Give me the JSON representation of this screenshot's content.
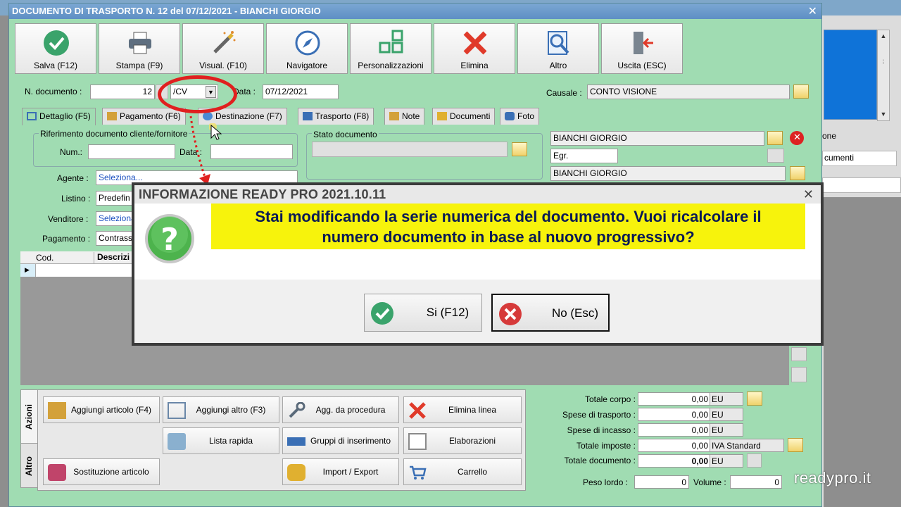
{
  "window": {
    "title": "DOCUMENTO DI TRASPORTO N. 12 del 07/12/2021 - BIANCHI GIORGIO",
    "close": "✕"
  },
  "toolbar": [
    {
      "label": "Salva (F12)",
      "icon": "check-icon"
    },
    {
      "label": "Stampa (F9)",
      "icon": "printer-icon"
    },
    {
      "label": "Visual. (F10)",
      "icon": "magic-wand-icon"
    },
    {
      "label": "Navigatore",
      "icon": "compass-icon"
    },
    {
      "label": "Personalizzazioni",
      "icon": "grid-icon"
    },
    {
      "label": "Elimina",
      "icon": "delete-x-icon"
    },
    {
      "label": "Altro",
      "icon": "magnifier-icon"
    },
    {
      "label": "Uscita (ESC)",
      "icon": "exit-door-icon"
    }
  ],
  "header": {
    "ndoc_label": "N. documento :",
    "ndoc_value": "12",
    "series_value": "/CV",
    "data_label": "Data :",
    "data_value": "07/12/2021",
    "causale_label": "Causale :",
    "causale_value": "CONTO VISIONE"
  },
  "tabs": [
    "Dettaglio (F5)",
    "Pagamento (F6)",
    "Destinazione (F7)",
    "Trasporto (F8)",
    "Note",
    "Documenti",
    "Foto"
  ],
  "riferimento": {
    "title": "Riferimento documento cliente/fornitore",
    "num_label": "Num.:",
    "data_label": "Data :"
  },
  "stato": {
    "title": "Stato documento"
  },
  "form": [
    {
      "label": "Agente :",
      "value": "Seleziona..."
    },
    {
      "label": "Listino :",
      "value": "Predefin"
    },
    {
      "label": "Venditore :",
      "value": "Seleziona"
    },
    {
      "label": "Pagamento :",
      "value": "Contrass"
    }
  ],
  "cliente": {
    "name": "BIANCHI GIORGIO",
    "salutation": "Egr.",
    "name2": "BIANCHI GIORGIO"
  },
  "grid": {
    "col_cod": "Cod.",
    "col_desc": "Descrizi"
  },
  "side_tabs": {
    "azioni": "Azioni",
    "altro": "Altro"
  },
  "actions": [
    {
      "label": "Aggiungi articolo (F4)",
      "icon": "add-article-icon"
    },
    {
      "label": "Aggiungi altro (F3)",
      "icon": "add-other-icon"
    },
    {
      "label": "Agg. da procedura",
      "icon": "wrench-icon"
    },
    {
      "label": "Elimina linea",
      "icon": "delete-x-icon"
    },
    {
      "label": "Lista rapida",
      "icon": "quick-list-icon"
    },
    {
      "label": "Gruppi di inserimento",
      "icon": "group-insert-icon"
    },
    {
      "label": "Elaborazioni",
      "icon": "processing-icon"
    },
    {
      "label": "Sostituzione articolo",
      "icon": "replace-icon"
    },
    {
      "label": "Import / Export",
      "icon": "import-export-icon"
    },
    {
      "label": "Carrello",
      "icon": "cart-icon"
    }
  ],
  "totals": [
    {
      "label": "Totale corpo :",
      "value": "0,00",
      "unit": "EU"
    },
    {
      "label": "Spese di trasporto :",
      "value": "0,00",
      "unit": "EU"
    },
    {
      "label": "Spese di incasso :",
      "value": "0,00",
      "unit": "EU"
    },
    {
      "label": "Totale imposte :",
      "value": "0,00",
      "unit": "IVA Standard"
    },
    {
      "label": "Totale documento :",
      "value": "0,00",
      "unit": "EU"
    }
  ],
  "weights": {
    "peso_label": "Peso lordo :",
    "peso_value": "0",
    "volume_label": "Volume :",
    "volume_value": "0"
  },
  "dialog": {
    "title": "INFORMAZIONE READY PRO 2021.10.11",
    "message_line1": "Stai modificando la serie numerica del documento. Vuoi ricalcolare il",
    "message_line2": "numero documento in base al nuovo progressivo?",
    "yes_label": "Si (F12)",
    "no_label": "No (Esc)",
    "close": "✕"
  },
  "background": {
    "side_label": "one",
    "side_field": "cumenti"
  },
  "watermark": "readypro.it",
  "colors": {
    "window_bg": "#a0dcb2",
    "titlebar": "#5e8fc4",
    "message_bg": "#f7f30c",
    "annotation": "#e0201f"
  }
}
